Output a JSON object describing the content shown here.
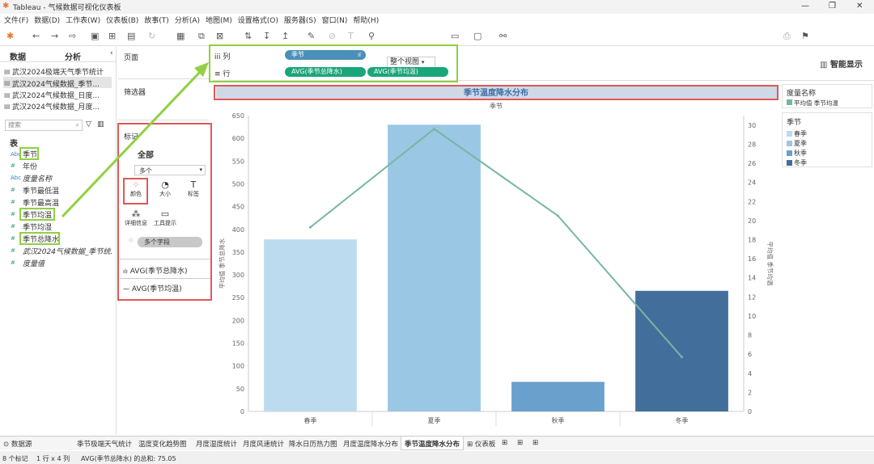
{
  "window": {
    "title": "Tableau - 气候数据可视化仪表板"
  },
  "menu": [
    "文件(F)",
    "数据(D)",
    "工作表(W)",
    "仪表板(B)",
    "故事(T)",
    "分析(A)",
    "地图(M)",
    "设置格式(O)",
    "服务器(S)",
    "窗口(N)",
    "帮助(H)"
  ],
  "toolbar": {
    "fit": "整个视图",
    "smart": "智能显示"
  },
  "left": {
    "tab_data": "数据",
    "tab_analysis": "分析",
    "datasources": [
      "武汉2024极端天气季节统计",
      "武汉2024气候数据_季节...",
      "武汉2024气候数据_日度...",
      "武汉2024气候数据_月度..."
    ],
    "search_placeholder": "搜索",
    "tables_header": "表",
    "fields": [
      {
        "type": "Abc",
        "name": "季节"
      },
      {
        "type": "#",
        "name": "年份"
      },
      {
        "type": "Abc",
        "name": "度量名称"
      },
      {
        "type": "#",
        "name": "季节最低温"
      },
      {
        "type": "#",
        "name": "季节最高温"
      },
      {
        "type": "#",
        "name": "季节均温"
      },
      {
        "type": "#",
        "name": "季节均湿"
      },
      {
        "type": "#",
        "name": "季节总降水"
      },
      {
        "type": "#",
        "name": "武汉2024气候数据_季节统..."
      },
      {
        "type": "#",
        "name": "度量值"
      }
    ]
  },
  "shelves": {
    "pages": "页面",
    "filters": "筛选器",
    "columns": "列",
    "rows": "行",
    "col_pill": "季节",
    "row_pill1": "AVG(季节总降水)",
    "row_pill2": "AVG(季节均温)"
  },
  "marks": {
    "title": "标记",
    "all": "全部",
    "type": "多个",
    "color": "颜色",
    "size": "大小",
    "label": "标签",
    "detail": "详细信息",
    "tooltip": "工具提示",
    "multi": "多个字段",
    "avg1": "AVG(季节总降水)",
    "avg2": "AVG(季节均温)"
  },
  "legend": {
    "measure_title": "度量名称",
    "measure_item": "平均值 季节均温",
    "season_title": "季节",
    "seasons": [
      "春季",
      "夏季",
      "秋季",
      "冬季"
    ]
  },
  "chart_data": {
    "type": "bar",
    "title": "季节温度降水分布",
    "column_header": "季节",
    "categories": [
      "春季",
      "夏季",
      "秋季",
      "冬季"
    ],
    "series": [
      {
        "values": [
          378,
          630,
          65,
          265
        ],
        "kind": "bar",
        "colors": [
          "#bcdbee",
          "#9ac7e4",
          "#6aa0cc",
          "#426e9c"
        ]
      },
      {
        "values": [
          19.3,
          29.6,
          20.5,
          5.7
        ],
        "kind": "line",
        "color": "#76b6a2"
      }
    ],
    "ylabel_left": "平均值 季节总降水",
    "ylabel_right": "平均值 季节均温",
    "ylim_left": [
      0,
      650
    ],
    "yticks_left": [
      0,
      50,
      100,
      150,
      200,
      250,
      300,
      350,
      400,
      450,
      500,
      550,
      600,
      650
    ],
    "ylim_right": [
      0,
      31
    ],
    "yticks_right": [
      0,
      2,
      4,
      6,
      8,
      10,
      12,
      14,
      16,
      18,
      20,
      22,
      24,
      26,
      28,
      30
    ]
  },
  "sheets": [
    "数据源",
    "季节极端天气统计",
    "温度变化趋势图",
    "月度湿度统计",
    "月度风速统计",
    "降水日历热力图",
    "月度温度降水分布",
    "季节温度降水分布",
    "仪表板"
  ],
  "status": {
    "marks": "8 个标记",
    "rowcol": "1 行 x 4 列",
    "sum": "AVG(季节总降水) 的总和: 75.05"
  }
}
